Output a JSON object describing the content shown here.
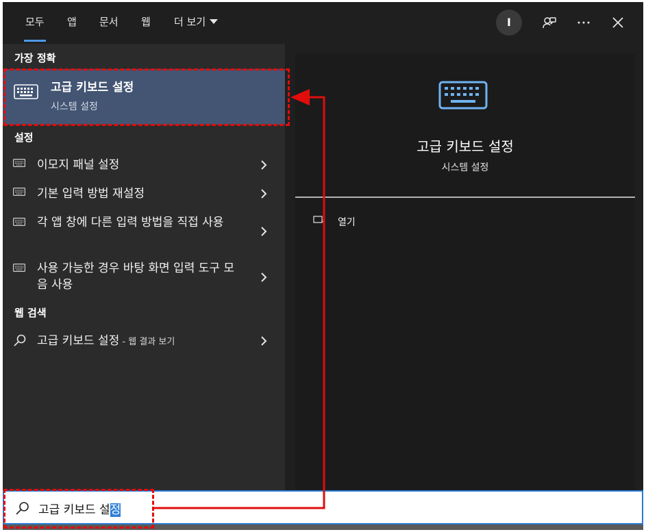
{
  "tabs": [
    {
      "label": "모두",
      "active": true
    },
    {
      "label": "앱"
    },
    {
      "label": "문서"
    },
    {
      "label": "웹"
    },
    {
      "label": "더 보기"
    }
  ],
  "header": {
    "avatar_initial": "I",
    "icons": [
      "feedback-icon",
      "more-icon",
      "close-icon"
    ]
  },
  "left": {
    "best_match_label": "가장 정확",
    "best_match": {
      "title": "고급 키보드 설정",
      "subtitle": "시스템 설정",
      "icon": "keyboard-icon"
    },
    "settings_label": "설정",
    "settings_items": [
      {
        "label": "이모지 패널 설정",
        "icon": "keyboard-icon"
      },
      {
        "label": "기본 입력 방법 재설정",
        "icon": "keyboard-icon"
      },
      {
        "label": "각 앱 창에 다른 입력 방법을 직접 사용",
        "icon": "keyboard-icon"
      },
      {
        "label": "사용 가능한 경우 바탕 화면 입력 도구 모음 사용",
        "icon": "keyboard-icon"
      }
    ],
    "web_label": "웹 검색",
    "web_item": {
      "query": "고급 키보드 설정",
      "suffix": " - 웹 결과 보기",
      "icon": "search-icon"
    }
  },
  "right": {
    "title": "고급 키보드 설정",
    "subtitle": "시스템 설정",
    "open_label": "열기",
    "accent": "#6fb3f2"
  },
  "search": {
    "value_before": "고급 키보드 설",
    "value_selected": "정",
    "icon": "search-icon"
  },
  "colors": {
    "highlight": "#435573",
    "annotation": "#e10d0d",
    "search_border": "#2a7bd3"
  }
}
